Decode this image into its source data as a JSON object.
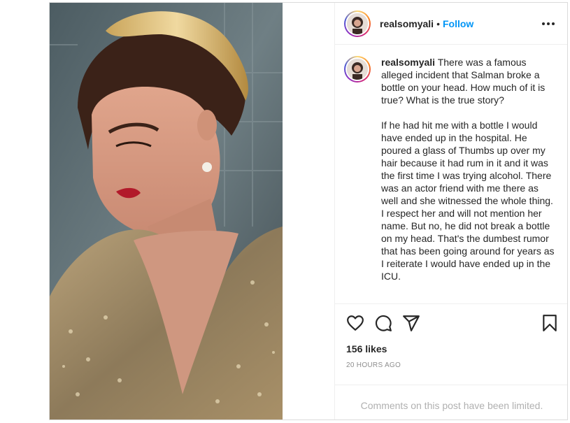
{
  "post": {
    "username": "realsomyali",
    "follow_label": "Follow",
    "separator": "•",
    "caption": {
      "username": "realsomyali",
      "text": " There was a famous alleged incident that Salman broke a bottle on your head. How much of it is true? What is the true story?\n\nIf he had hit me with a bottle I would have ended up in the hospital. He poured a glass of Thumbs up over my hair because it had rum in it and it was the first time I was trying alcohol. There was an actor friend with me there as well and she witnessed the whole thing. I respect her and will not mention her name. But no, he did not break a bottle on my head. That's the dumbest rumor that has been going around for years as I reiterate I would have ended up in the ICU."
    },
    "likes": "156 likes",
    "timestamp": "20 HOURS AGO",
    "comments_limited": "Comments on this post have been limited."
  },
  "icons": {
    "more": "more-options-icon",
    "like": "heart-icon",
    "comment": "comment-icon",
    "share": "share-icon",
    "save": "bookmark-icon"
  },
  "colors": {
    "link": "#0095f6",
    "text": "#262626",
    "muted": "#8e8e8e",
    "border": "#dbdbdb"
  }
}
